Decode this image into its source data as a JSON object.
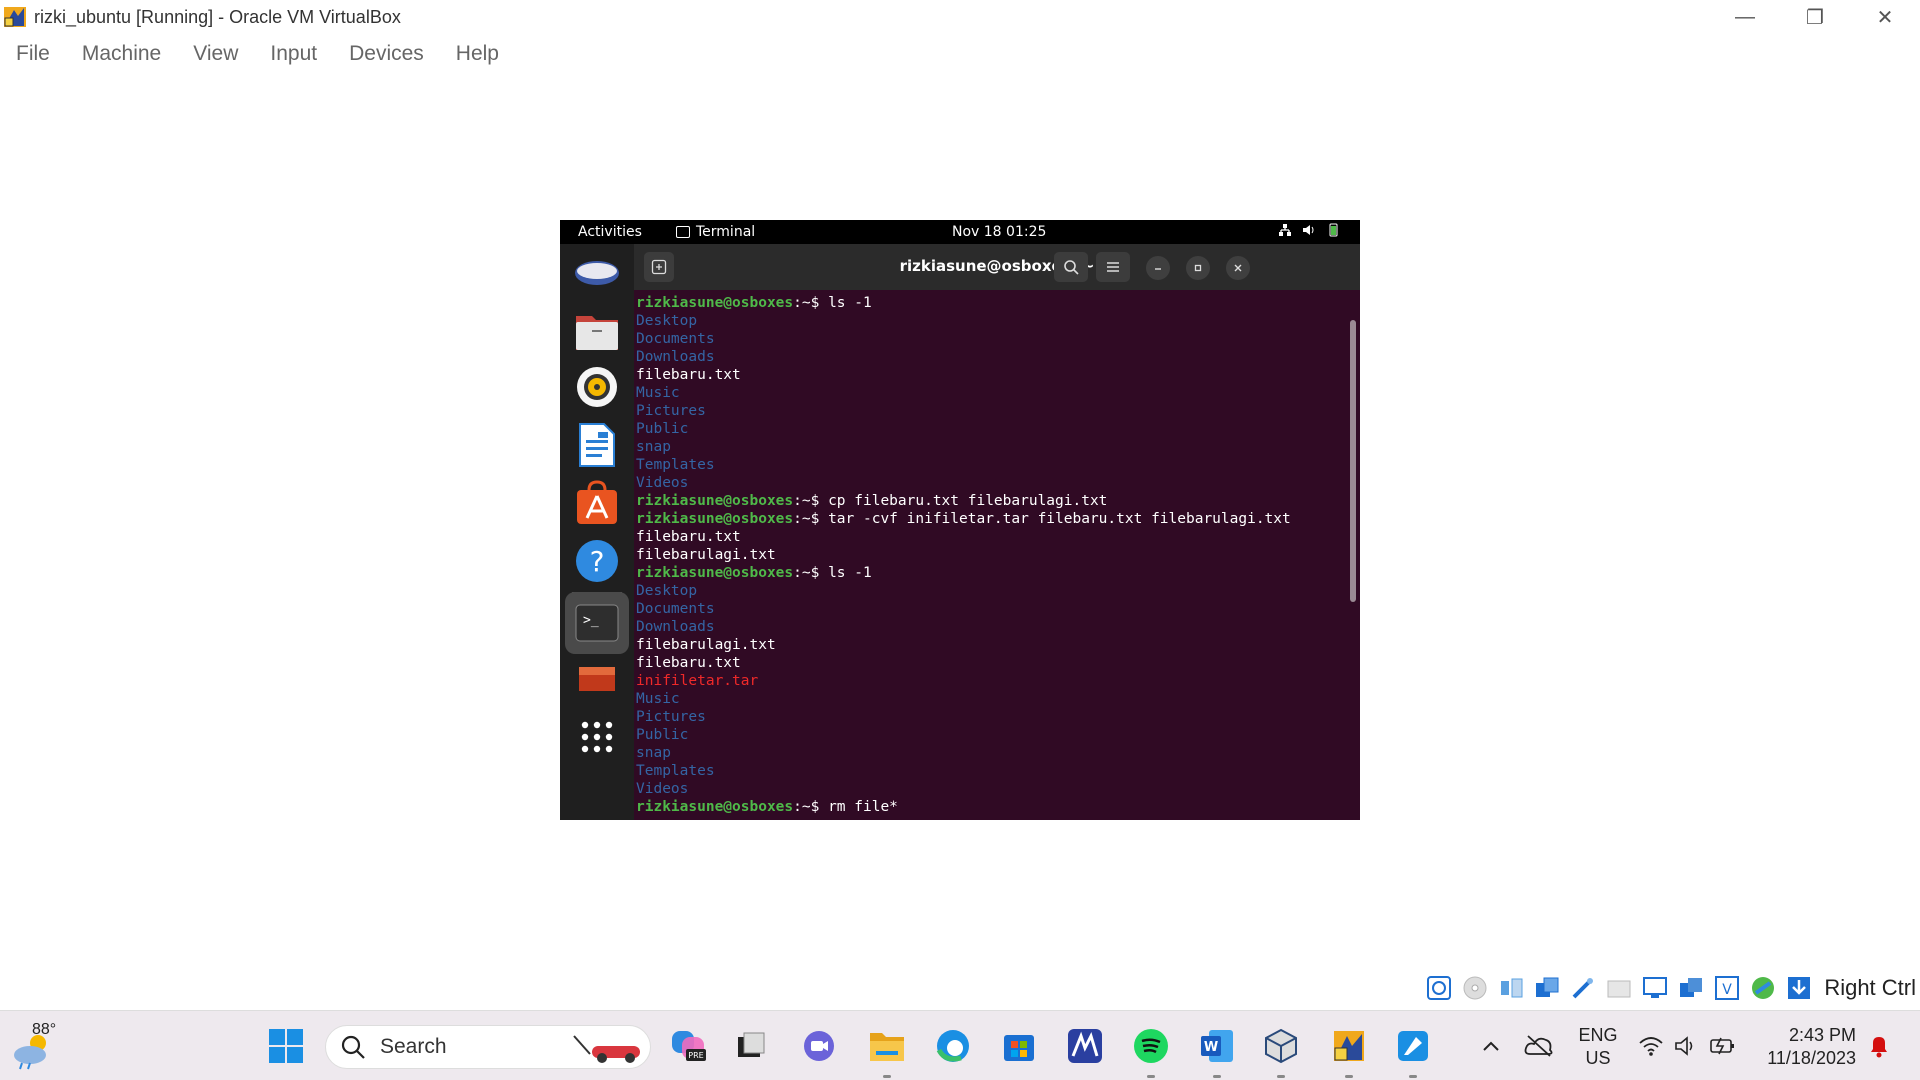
{
  "window": {
    "title": "rizki_ubuntu [Running] - Oracle VM VirtualBox",
    "menu": [
      "File",
      "Machine",
      "View",
      "Input",
      "Devices",
      "Help"
    ],
    "minimize_glyph": "—",
    "restore_glyph": "❐",
    "close_glyph": "✕"
  },
  "gnome": {
    "activities": "Activities",
    "app_name": "Terminal",
    "clock": "Nov 18  01:25"
  },
  "terminal": {
    "title": "rizkiasune@osboxes: ~",
    "prompt_user": "rizkiasune@osboxes",
    "prompt_suffix": ":~$ ",
    "lines": [
      {
        "type": "cmd",
        "text": "ls -1"
      },
      {
        "type": "dir",
        "text": "Desktop"
      },
      {
        "type": "dir",
        "text": "Documents"
      },
      {
        "type": "dir",
        "text": "Downloads"
      },
      {
        "type": "file",
        "text": "filebaru.txt"
      },
      {
        "type": "dir",
        "text": "Music"
      },
      {
        "type": "dir",
        "text": "Pictures"
      },
      {
        "type": "dir",
        "text": "Public"
      },
      {
        "type": "dir",
        "text": "snap"
      },
      {
        "type": "dir",
        "text": "Templates"
      },
      {
        "type": "dir",
        "text": "Videos"
      },
      {
        "type": "cmd",
        "text": "cp filebaru.txt filebarulagi.txt"
      },
      {
        "type": "cmd",
        "text": "tar -cvf inifiletar.tar filebaru.txt filebarulagi.txt"
      },
      {
        "type": "file",
        "text": "filebaru.txt"
      },
      {
        "type": "file",
        "text": "filebarulagi.txt"
      },
      {
        "type": "cmd",
        "text": "ls -1"
      },
      {
        "type": "dir",
        "text": "Desktop"
      },
      {
        "type": "dir",
        "text": "Documents"
      },
      {
        "type": "dir",
        "text": "Downloads"
      },
      {
        "type": "file",
        "text": "filebarulagi.txt"
      },
      {
        "type": "file",
        "text": "filebaru.txt"
      },
      {
        "type": "arc",
        "text": "inifiletar.tar"
      },
      {
        "type": "dir",
        "text": "Music"
      },
      {
        "type": "dir",
        "text": "Pictures"
      },
      {
        "type": "dir",
        "text": "Public"
      },
      {
        "type": "dir",
        "text": "snap"
      },
      {
        "type": "dir",
        "text": "Templates"
      },
      {
        "type": "dir",
        "text": "Videos"
      },
      {
        "type": "cmd",
        "text": "rm file*"
      }
    ]
  },
  "dock": [
    "ubuntu-logo-icon",
    "files-icon",
    "rhythmbox-icon",
    "writer-icon",
    "app-center-icon",
    "help-icon",
    "terminal-icon",
    "ubuntu-desktop-icon",
    "show-apps-icon"
  ],
  "vbox_status": {
    "host_key": "Right Ctrl"
  },
  "taskbar": {
    "weather_temp": "88°",
    "search_label": "Search",
    "lang_line1": "ENG",
    "lang_line2": "US",
    "time": "2:43 PM",
    "date": "11/18/2023"
  },
  "colors": {
    "terminal_bg": "#300a24",
    "prompt_green": "#4fb949",
    "dir_blue": "#3465a4",
    "archive_red": "#ef2929",
    "ubuntu_orange": "#e95420"
  }
}
